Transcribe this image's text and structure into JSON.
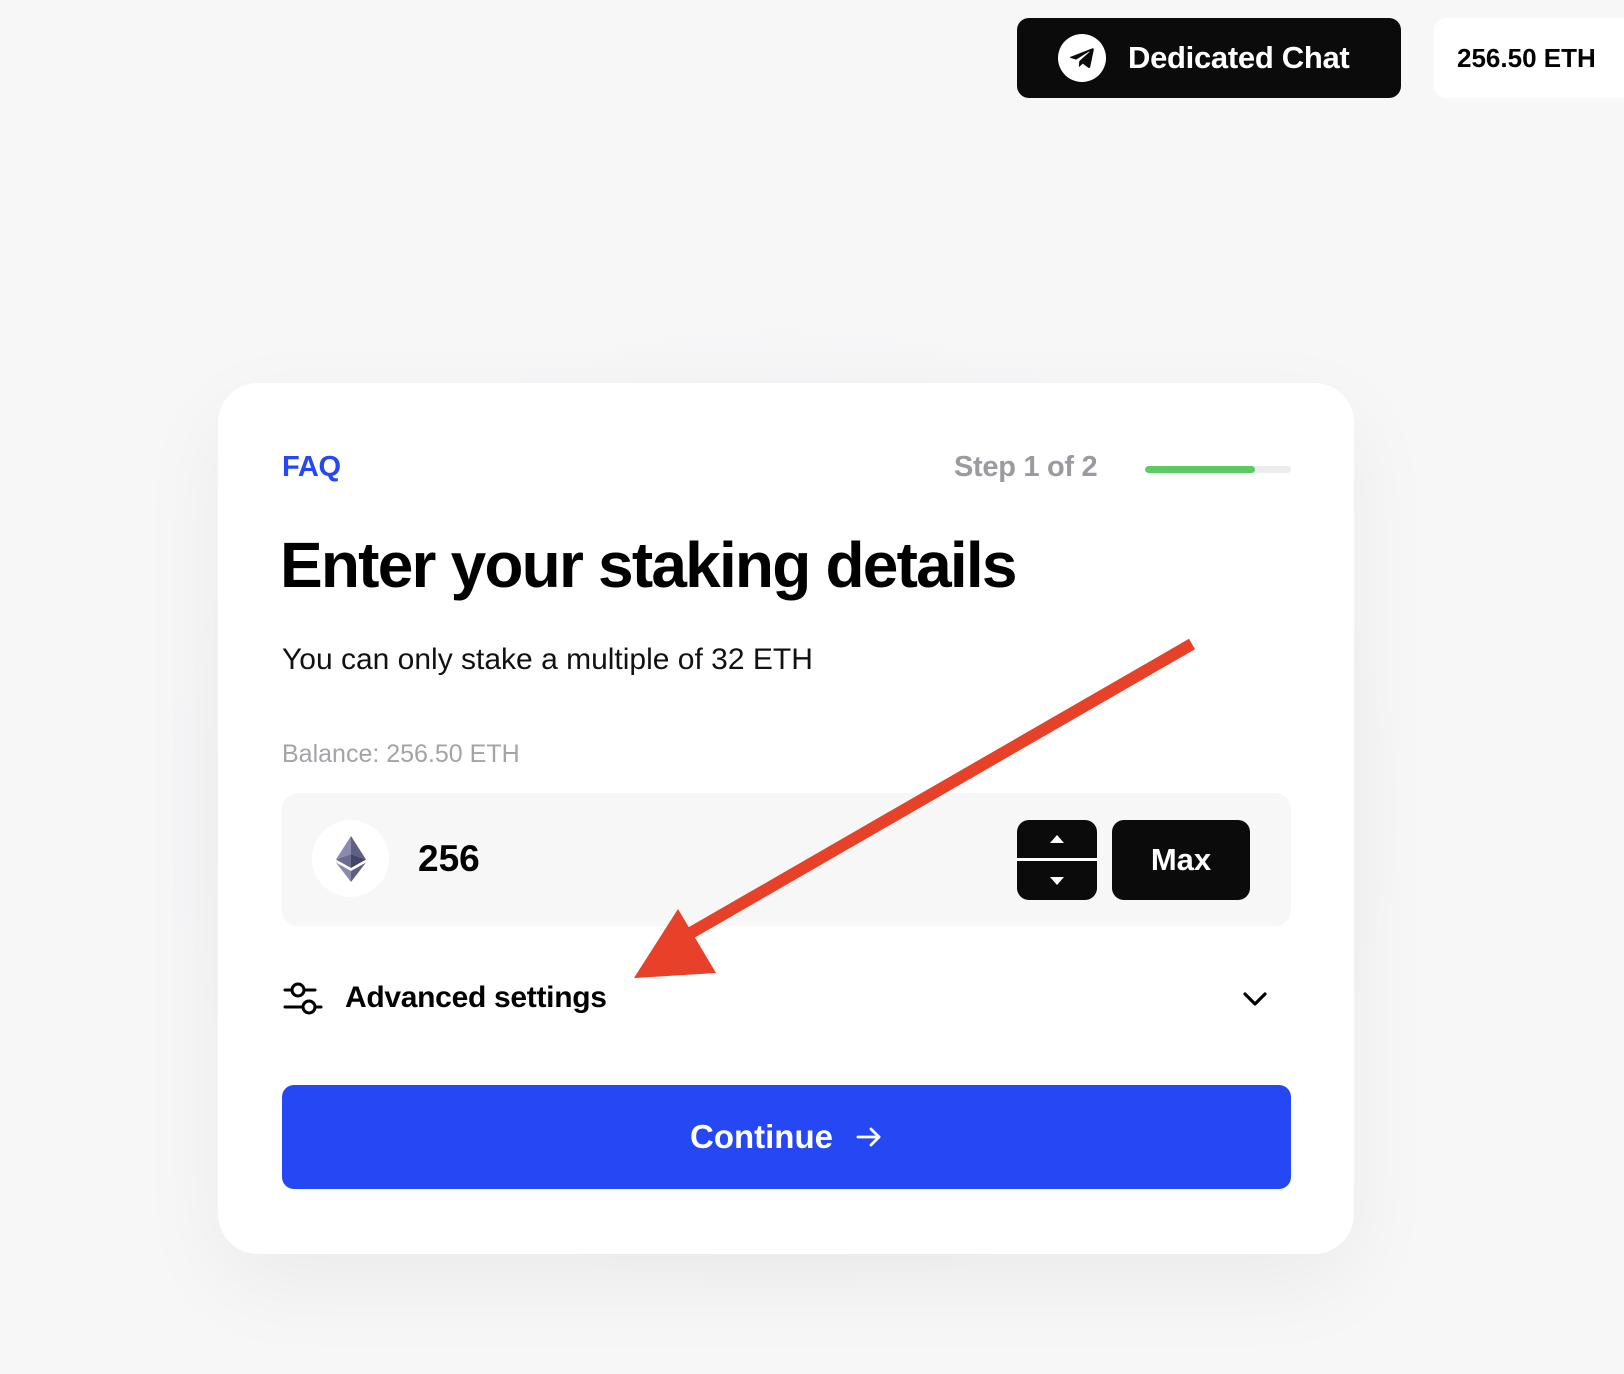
{
  "header": {
    "chat_button_label": "Dedicated Chat",
    "chat_icon": "telegram-icon",
    "wallet_balance": "256.50 ETH"
  },
  "card": {
    "faq_label": "FAQ",
    "step_label": "Step 1 of 2",
    "progress_fraction": 0.75,
    "progress_color": "#5ccb63",
    "title": "Enter your staking details",
    "subtitle": "You can only stake a multiple of 32 ETH",
    "balance_label": "Balance: 256.50 ETH",
    "amount": {
      "value": "256",
      "token_icon": "ethereum-icon",
      "stepper_icons": [
        "caret-up-icon",
        "caret-down-icon"
      ],
      "max_label": "Max"
    },
    "advanced": {
      "label": "Advanced settings",
      "icon": "sliders-icon",
      "toggle_icon": "chevron-down-icon"
    },
    "continue_label": "Continue",
    "continue_icon": "arrow-right-icon"
  },
  "colors": {
    "accent": "#2547f4",
    "dark": "#0b0b0c",
    "annotation": "#e8412a"
  }
}
